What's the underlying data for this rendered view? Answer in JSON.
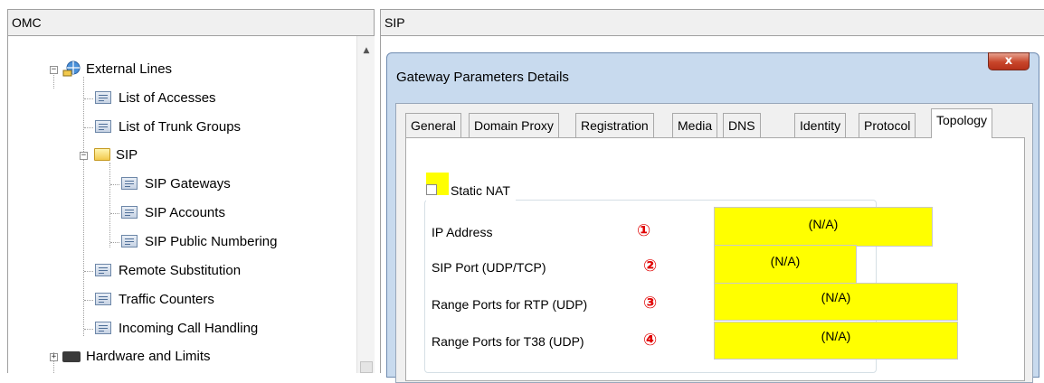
{
  "headers": {
    "left": "OMC",
    "right": "SIP"
  },
  "tree": {
    "items": [
      {
        "label": "External Lines",
        "icon": "external-lines-icon",
        "expander": "−"
      },
      {
        "label": "List of Accesses",
        "icon": "document-icon"
      },
      {
        "label": "List of Trunk Groups",
        "icon": "document-icon"
      },
      {
        "label": "SIP",
        "icon": "folder-icon",
        "expander": "−"
      },
      {
        "label": "SIP Gateways",
        "icon": "document-icon"
      },
      {
        "label": "SIP Accounts",
        "icon": "document-icon"
      },
      {
        "label": "SIP Public Numbering",
        "icon": "document-icon"
      },
      {
        "label": "Remote Substitution",
        "icon": "document-icon"
      },
      {
        "label": "Traffic Counters",
        "icon": "document-icon"
      },
      {
        "label": "Incoming Call Handling",
        "icon": "document-icon"
      },
      {
        "label": "Hardware and Limits",
        "icon": "hardware-icon",
        "expander": "+"
      }
    ]
  },
  "dialog": {
    "title": "Gateway Parameters Details",
    "close_label": "x",
    "tabs": [
      "General",
      "Domain Proxy",
      "Registration",
      "Media",
      "DNS",
      "Identity",
      "Protocol",
      "Topology"
    ],
    "active_tab": "Topology",
    "group": {
      "label": "Static NAT",
      "checked": false
    },
    "fields": [
      {
        "label": "IP Address",
        "marker": "①",
        "value": "(N/A)"
      },
      {
        "label": "SIP Port (UDP/TCP)",
        "marker": "②",
        "value": "(N/A)"
      },
      {
        "label": "Range Ports for RTP (UDP)",
        "marker": "③",
        "value": "(N/A)"
      },
      {
        "label": "Range Ports for T38 (UDP)",
        "marker": "④",
        "value": "(N/A)"
      }
    ]
  },
  "colors": {
    "highlight": "#ffff00",
    "marker": "#e00000",
    "dialog_frame": "#c8daee",
    "close_button": "#c8452a"
  }
}
